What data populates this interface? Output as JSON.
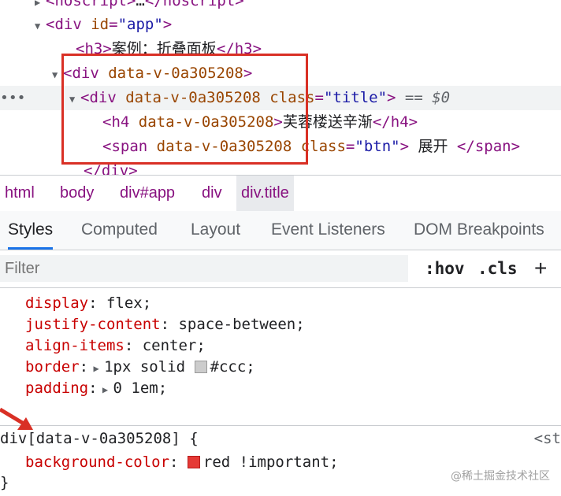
{
  "dom_tree": {
    "lines": [
      {
        "open": "<",
        "tag": "noscript",
        "mid": ">…</",
        "tag2": "noscript",
        "close": ">"
      },
      {
        "tag": "div",
        "attr": "id",
        "val": "\"app\""
      },
      {
        "tag": "h3",
        "text": "案例：折叠面板",
        "endtag": "h3"
      },
      {
        "tag": "div",
        "attr": "data-v-0a305208"
      },
      {
        "tag": "div",
        "attr": "data-v-0a305208",
        "attr2": "class",
        "val2": "\"title\"",
        "suffix": "== $0"
      },
      {
        "tag": "h4",
        "attr": "data-v-0a305208",
        "text": "芙蓉楼送辛渐",
        "endtag": "h4"
      },
      {
        "tag": "span",
        "attr": "data-v-0a305208",
        "attr2": "class",
        "val2": "\"btn\"",
        "text": " 展开 ",
        "endtag": "span"
      },
      {
        "endtag": "div"
      }
    ],
    "dots": "•••"
  },
  "breadcrumb": [
    "html",
    "body",
    "div#app",
    "div",
    "div.title"
  ],
  "tabs": [
    "Styles",
    "Computed",
    "Layout",
    "Event Listeners",
    "DOM Breakpoints"
  ],
  "filter": {
    "placeholder": "Filter",
    "hov": ":hov",
    "cls": ".cls",
    "plus": "+"
  },
  "rule1": [
    {
      "prop": "display",
      "value": "flex"
    },
    {
      "prop": "justify-content",
      "value": "space-between"
    },
    {
      "prop": "align-items",
      "value": "center"
    },
    {
      "prop": "border",
      "value": "1px solid",
      "swatch": "#cccccc",
      "value2": "#ccc"
    },
    {
      "prop": "padding",
      "value": "0 1em"
    }
  ],
  "rule2": {
    "selector": "div[data-v-0a305208] {",
    "prop": "background-color",
    "swatch": "#e53935",
    "value": "red !important",
    "close": "}",
    "source": "<st"
  },
  "watermark": "@稀土掘金技术社区",
  "colors": {
    "highlight_box": "#d93025",
    "tab_active": "#1a73e8",
    "arrow": "#d93025"
  }
}
